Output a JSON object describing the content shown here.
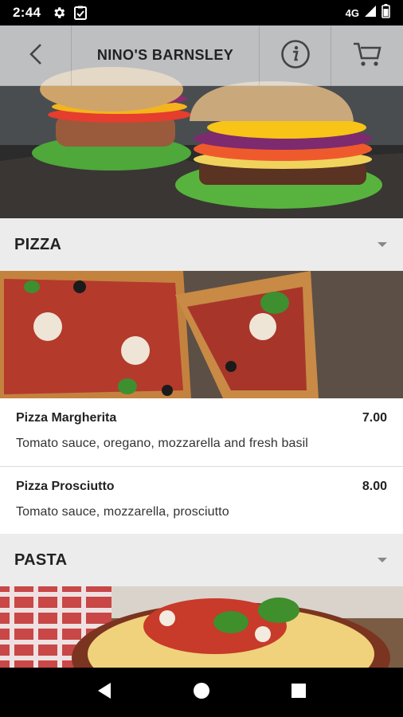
{
  "status_bar": {
    "time": "2:44",
    "network": "4G",
    "icons": [
      "settings-icon",
      "clipboard-icon",
      "signal-icon",
      "battery-icon"
    ]
  },
  "header": {
    "title": "NINO'S BARNSLEY",
    "icons": [
      "back-arrow-icon",
      "info-icon",
      "cart-icon"
    ]
  },
  "categories": [
    {
      "label": "PIZZA",
      "items": [
        {
          "name": "Pizza Margherita",
          "price": "7.00",
          "description": "Tomato sauce, oregano, mozzarella and fresh basil"
        },
        {
          "name": "Pizza Prosciutto",
          "price": "8.00",
          "description": "Tomato sauce, mozzarella, prosciutto"
        }
      ]
    },
    {
      "label": "PASTA",
      "items": []
    }
  ],
  "nav_bar": {
    "icons": [
      "nav-back-icon",
      "nav-home-icon",
      "nav-recents-icon"
    ]
  },
  "colors": {
    "status_bar": "#000000",
    "category_bar": "#ececec",
    "item_bg": "#ffffff",
    "text": "#222222"
  }
}
